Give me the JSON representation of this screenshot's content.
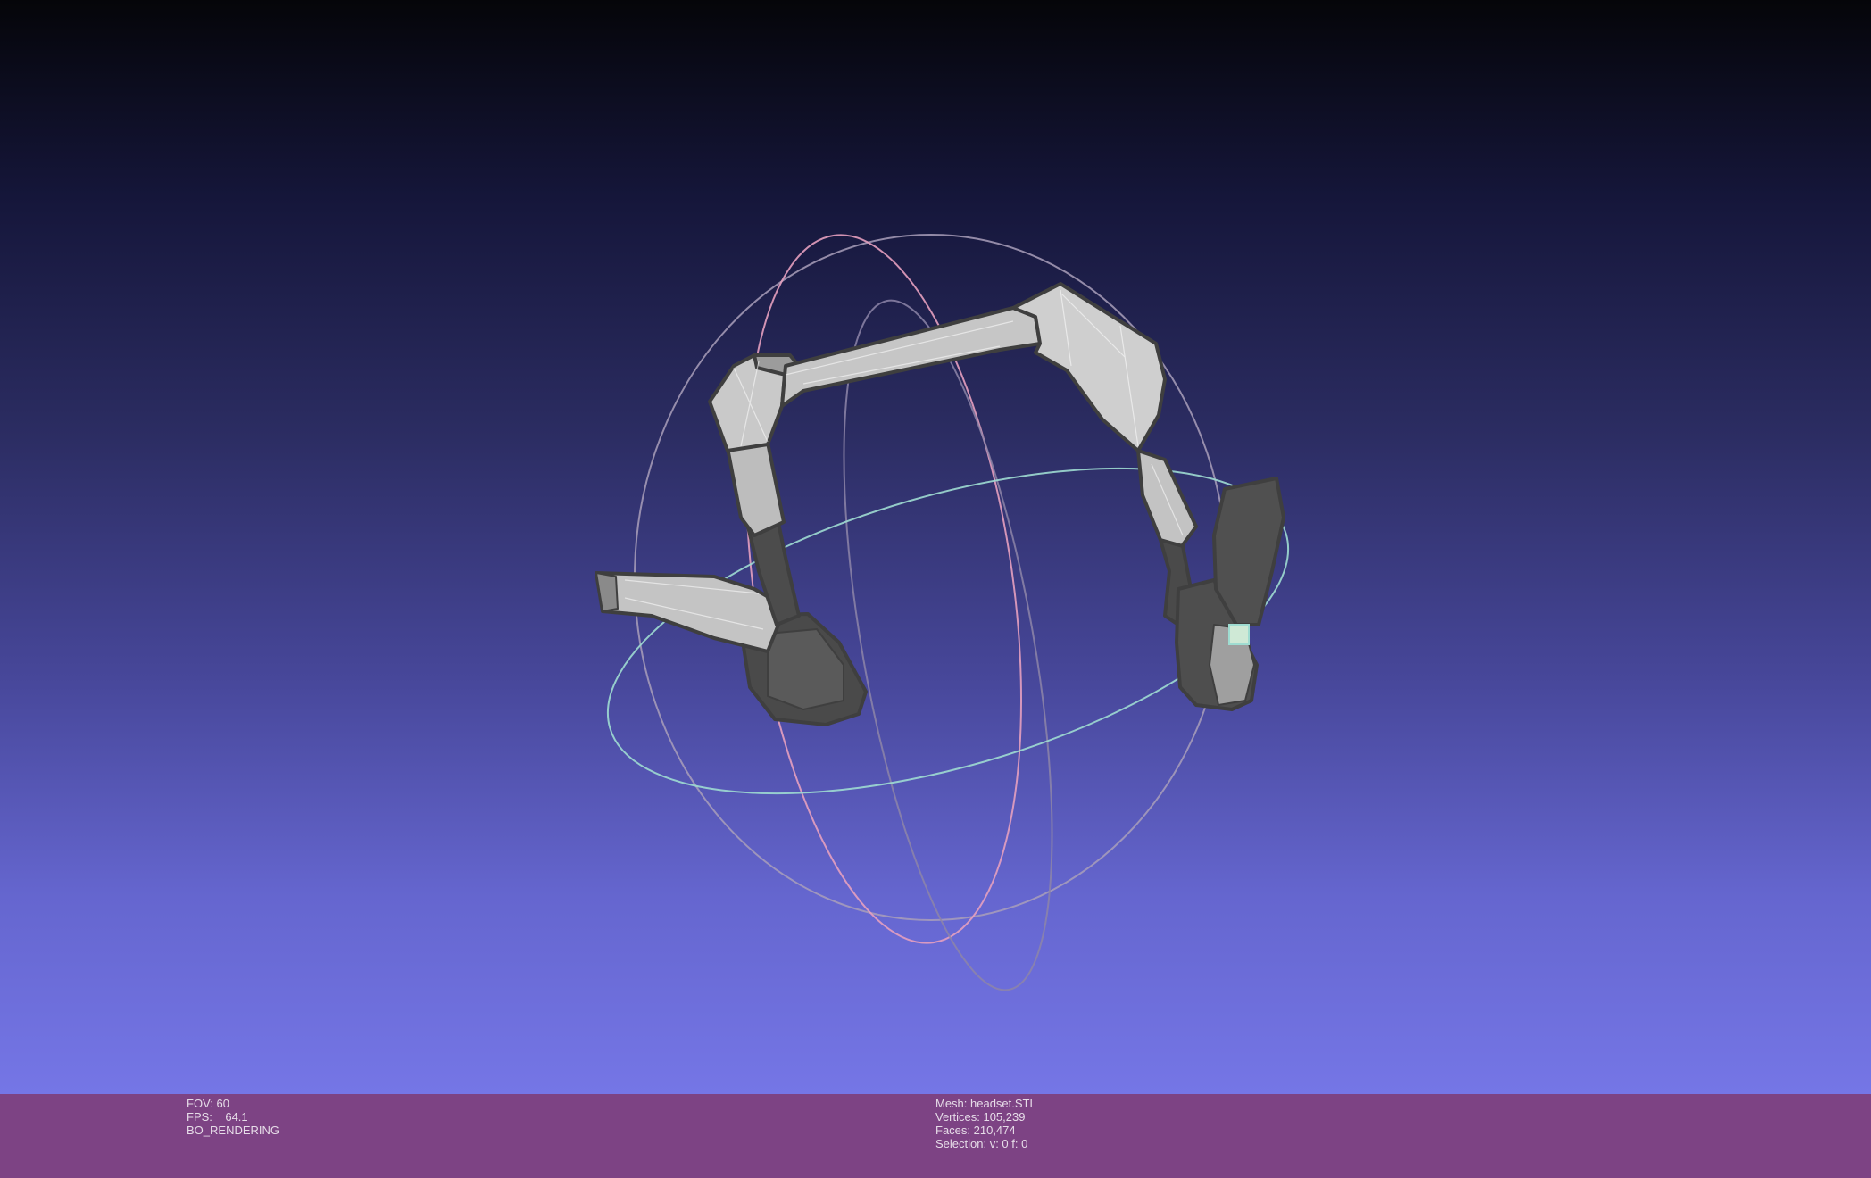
{
  "viewport": {
    "mesh_fill": "#bfbfbf",
    "mesh_edge": "#3f3f3f",
    "trackball_colors": [
      "#e8a2c0",
      "#b7b0c6",
      "#a6e6d6"
    ]
  },
  "render_info": {
    "fov": "FOV: 60",
    "fps": "FPS:    64.1",
    "mode": "BO_RENDERING"
  },
  "mesh_info": {
    "mesh": "Mesh: headset.STL",
    "vertices": "Vertices: 105,239",
    "faces": "Faces: 210,474",
    "selection": "Selection: v: 0 f: 0"
  }
}
